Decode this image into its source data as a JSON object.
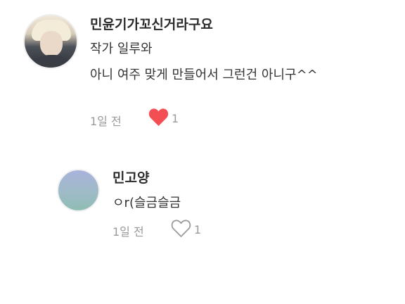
{
  "comment": {
    "username": "민윤기가꼬신거라구요",
    "lines": [
      "작가 일루와",
      "아니 여주 맞게 만들어서 그런건 아니구^^"
    ],
    "time": "1일 전",
    "like_count": "1",
    "liked": true,
    "heart_color": "#f44e55"
  },
  "reply": {
    "username": "민고양",
    "text": "ㅇr(슬금슬금",
    "time": "1일 전",
    "like_count": "1",
    "liked": false,
    "heart_color": "#9a9a9a"
  }
}
